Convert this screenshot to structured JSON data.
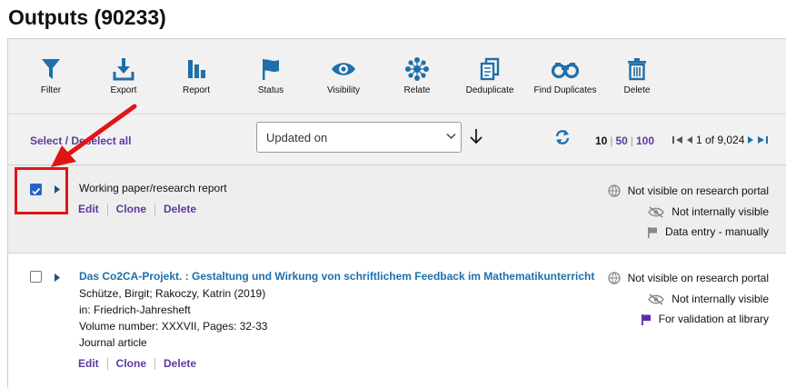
{
  "page": {
    "title": "Outputs (90233)"
  },
  "toolbar": {
    "filter": "Filter",
    "export": "Export",
    "report": "Report",
    "status": "Status",
    "visibility": "Visibility",
    "relate": "Relate",
    "deduplicate": "Deduplicate",
    "find_duplicates": "Find Duplicates",
    "delete": "Delete",
    "accent": "#1f6fa8"
  },
  "selection": {
    "select_deselect": "Select / Deselect all",
    "sort_value": "Updated on",
    "per_page": [
      "10",
      "50",
      "100"
    ],
    "per_page_selected": "10",
    "page_info": "1 of 9,024"
  },
  "items": [
    {
      "checked": true,
      "title": "Working paper/research report",
      "actions": [
        "Edit",
        "Clone",
        "Delete"
      ],
      "status": [
        "Not visible on research portal",
        "Not internally visible",
        "Data entry - manually"
      ]
    },
    {
      "checked": false,
      "title": "Das Co2CA-Projekt. : Gestaltung und Wirkung von schriftlichem Feedback im Mathematikunterricht",
      "authors": "Schütze, Birgit; Rakoczy, Katrin (2019)",
      "in": "in: Friedrich-Jahresheft",
      "volume": "Volume number: XXXVII, Pages: 32-33",
      "type": "Journal article",
      "actions": [
        "Edit",
        "Clone",
        "Delete"
      ],
      "status": [
        "Not visible on research portal",
        "Not internally visible",
        "For validation at library"
      ]
    }
  ]
}
